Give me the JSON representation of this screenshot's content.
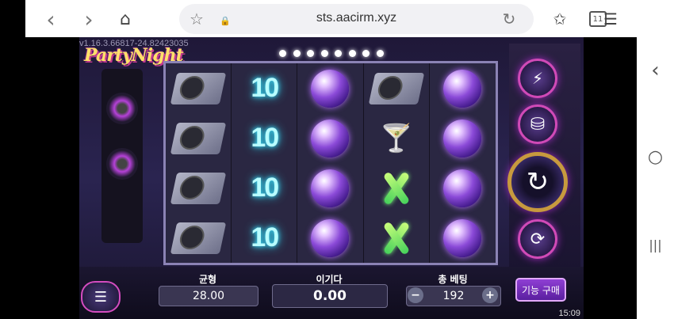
{
  "browser": {
    "url": "sts.aacirm.xyz",
    "tab_count": "11",
    "back_icon": "‹",
    "forward_icon": "›",
    "home_icon": "⌂",
    "bookmark_icon": "☆",
    "lock_icon": "🔒",
    "reload_icon": "↻",
    "favorites_icon": "✩",
    "menu_icon": "☰"
  },
  "system_bar": {
    "back": "‹",
    "home": "○",
    "recents": "|||"
  },
  "game": {
    "version": "v1.16.3.66817-24.82423035",
    "logo": "PartyNight",
    "reels": [
      [
        "turntable",
        "10",
        "disco",
        "turntable",
        "disco"
      ],
      [
        "turntable",
        "10",
        "disco",
        "drink",
        "disco"
      ],
      [
        "turntable",
        "10",
        "disco",
        "glowstick",
        "disco"
      ],
      [
        "turntable",
        "10",
        "disco",
        "glowstick",
        "disco"
      ]
    ],
    "symbol_text": {
      "ten": "10",
      "drink": "🍸"
    },
    "side_buttons": {
      "turbo": "⚡",
      "coins": "⛁",
      "spin": "↻",
      "auto": "⟳"
    },
    "bottom": {
      "menu_icon": "☰",
      "balance_label": "균형",
      "balance_value": "28.00",
      "win_label": "이기다",
      "win_value": "0.00",
      "bet_label": "총 베팅",
      "bet_value": "192",
      "minus": "−",
      "plus": "+",
      "buy_feature": "기능 구매"
    },
    "clock": "15:09"
  }
}
